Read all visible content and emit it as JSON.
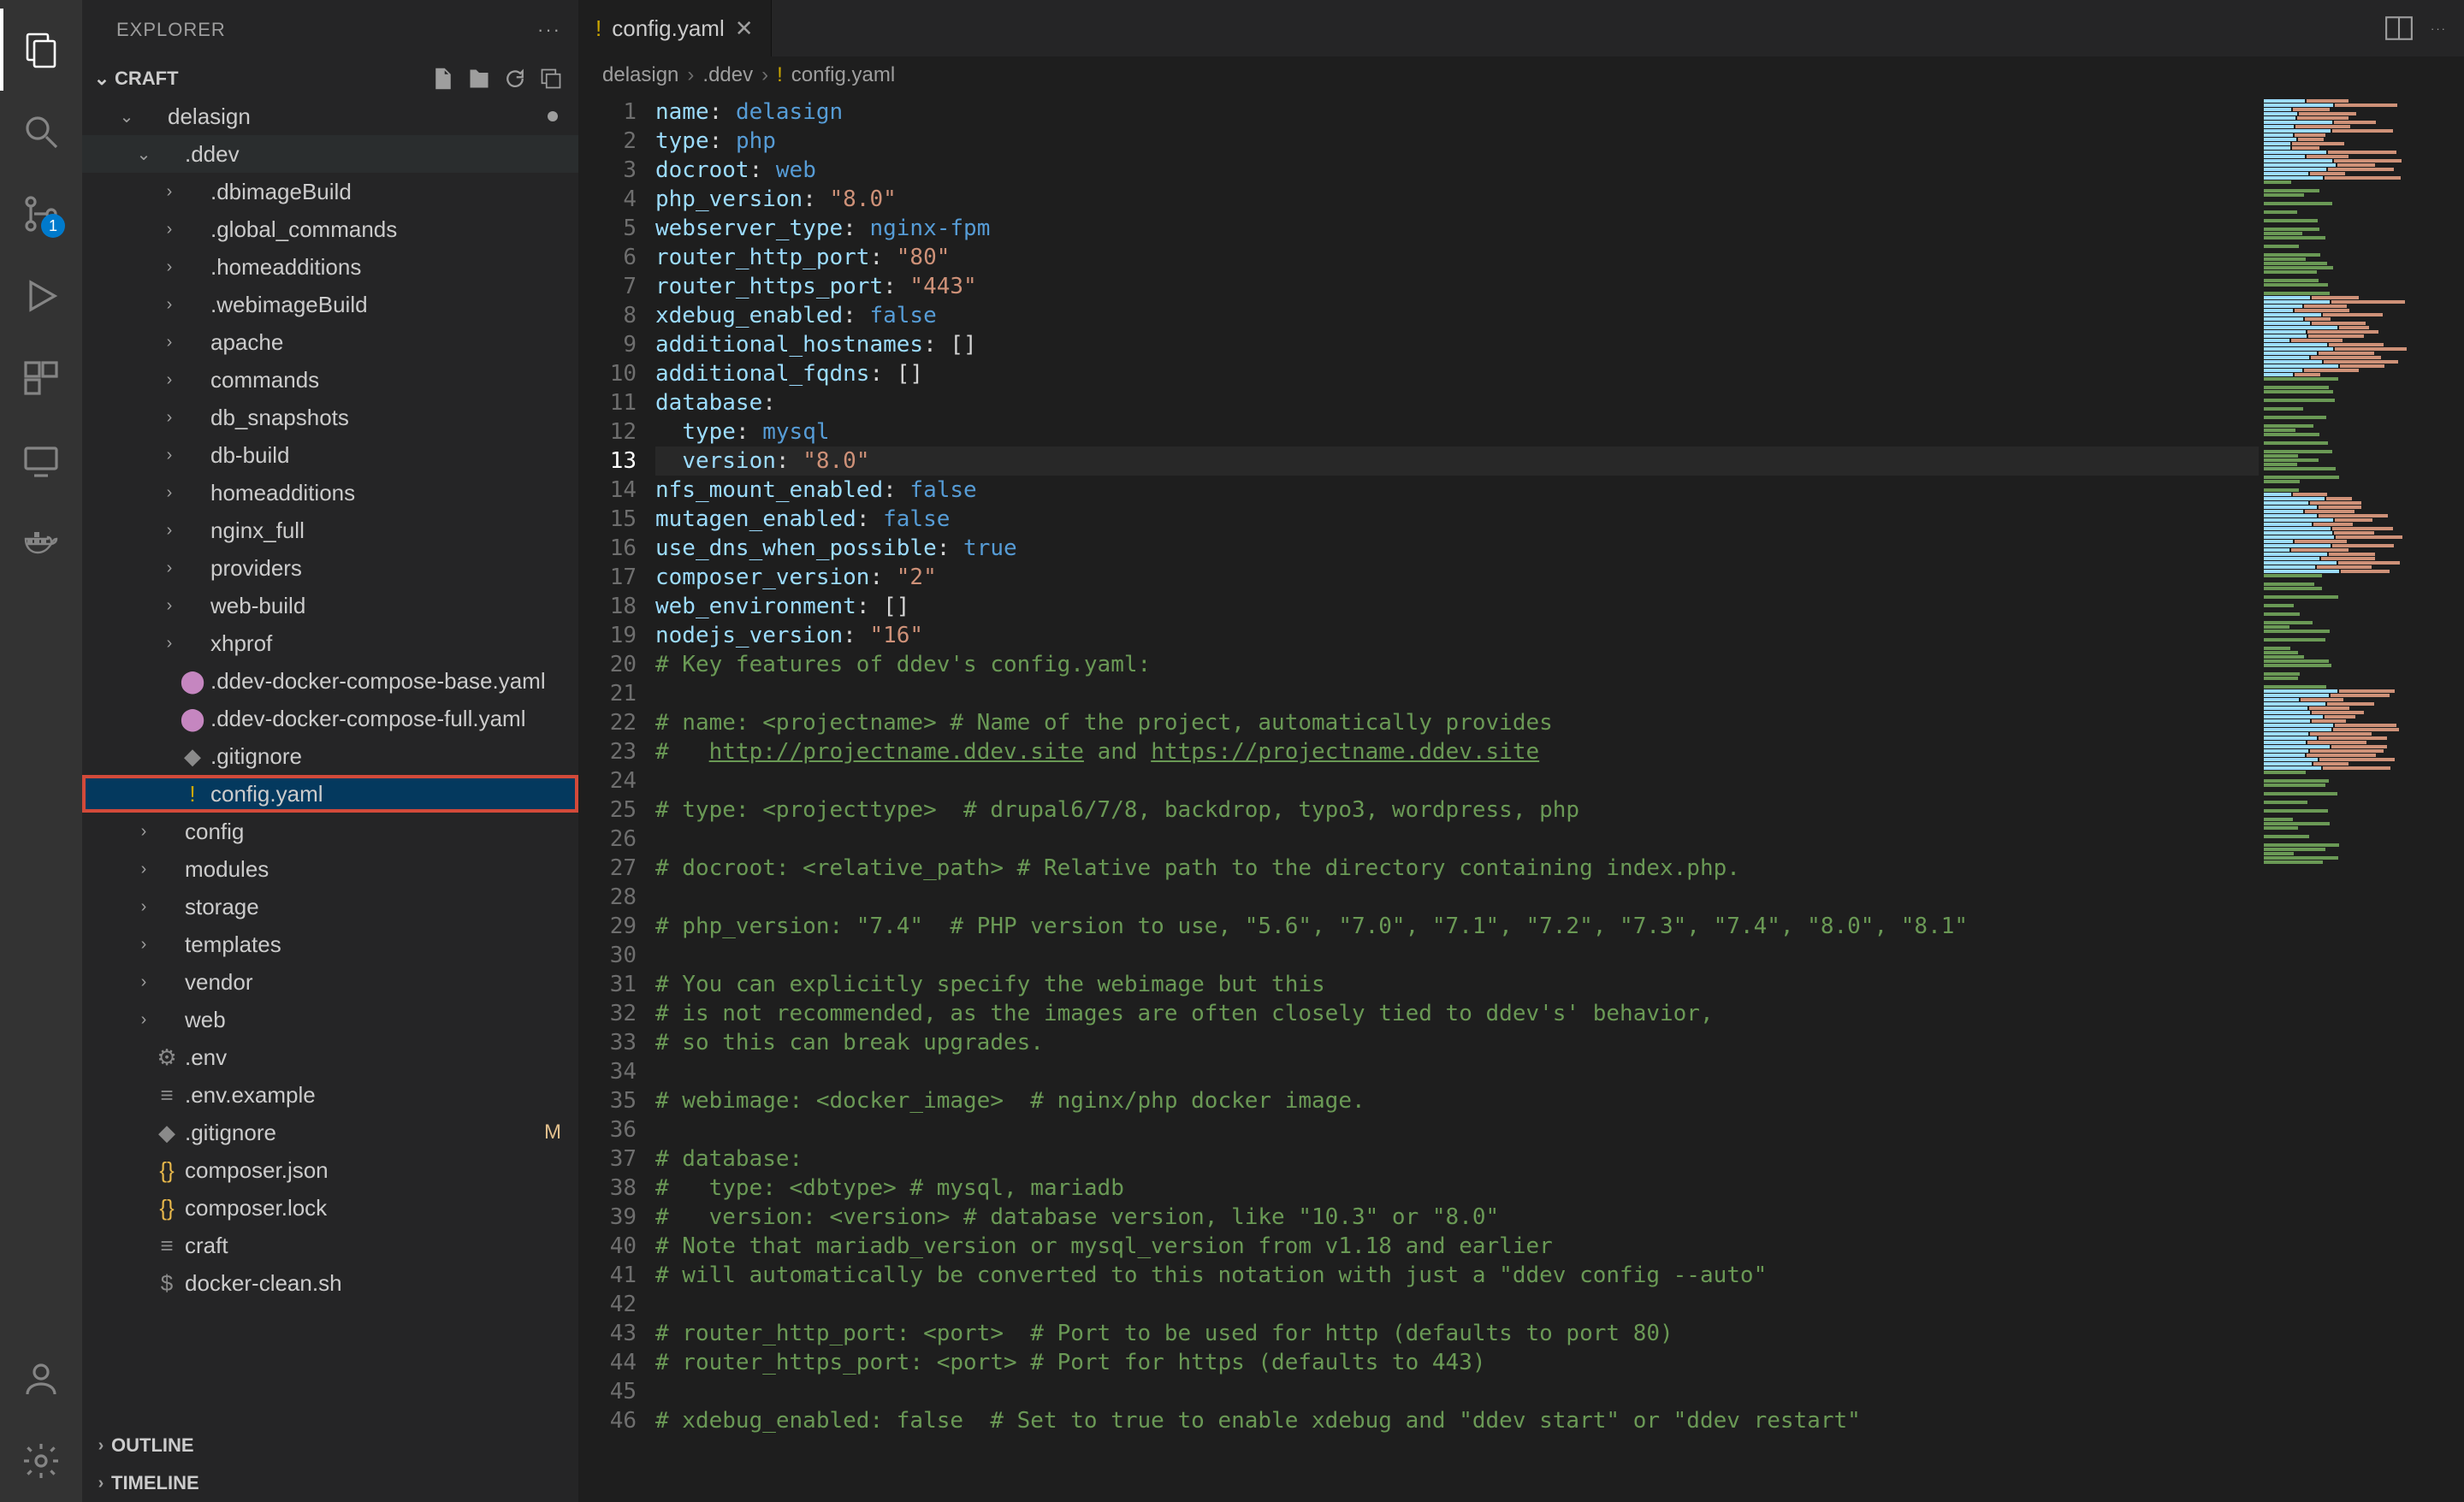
{
  "explorer_title": "EXPLORER",
  "workspace_name": "CRAFT",
  "branch_badge": "1",
  "sidebar_sections": {
    "outline": "OUTLINE",
    "timeline": "TIMELINE"
  },
  "tree": [
    {
      "indent": 0,
      "k": "folder-open",
      "label": "delasign",
      "dot": true
    },
    {
      "indent": 1,
      "k": "folder-open",
      "label": ".ddev",
      "hover": true
    },
    {
      "indent": 2,
      "k": "folder",
      "label": ".dbimageBuild"
    },
    {
      "indent": 2,
      "k": "folder",
      "label": ".global_commands"
    },
    {
      "indent": 2,
      "k": "folder",
      "label": ".homeadditions"
    },
    {
      "indent": 2,
      "k": "folder",
      "label": ".webimageBuild"
    },
    {
      "indent": 2,
      "k": "folder",
      "label": "apache"
    },
    {
      "indent": 2,
      "k": "folder",
      "label": "commands"
    },
    {
      "indent": 2,
      "k": "folder",
      "label": "db_snapshots"
    },
    {
      "indent": 2,
      "k": "folder",
      "label": "db-build"
    },
    {
      "indent": 2,
      "k": "folder",
      "label": "homeadditions"
    },
    {
      "indent": 2,
      "k": "folder",
      "label": "nginx_full"
    },
    {
      "indent": 2,
      "k": "folder",
      "label": "providers"
    },
    {
      "indent": 2,
      "k": "folder",
      "label": "web-build"
    },
    {
      "indent": 2,
      "k": "folder",
      "label": "xhprof"
    },
    {
      "indent": 2,
      "k": "yaml-pink",
      "label": ".ddev-docker-compose-base.yaml"
    },
    {
      "indent": 2,
      "k": "yaml-pink",
      "label": ".ddev-docker-compose-full.yaml"
    },
    {
      "indent": 2,
      "k": "gitignore",
      "label": ".gitignore"
    },
    {
      "indent": 2,
      "k": "yaml-warn",
      "label": "config.yaml",
      "selected": true
    },
    {
      "indent": 1,
      "k": "folder",
      "label": "config"
    },
    {
      "indent": 1,
      "k": "folder",
      "label": "modules"
    },
    {
      "indent": 1,
      "k": "folder",
      "label": "storage"
    },
    {
      "indent": 1,
      "k": "folder",
      "label": "templates"
    },
    {
      "indent": 1,
      "k": "folder",
      "label": "vendor"
    },
    {
      "indent": 1,
      "k": "folder",
      "label": "web"
    },
    {
      "indent": 1,
      "k": "gear",
      "label": ".env"
    },
    {
      "indent": 1,
      "k": "lines",
      "label": ".env.example"
    },
    {
      "indent": 1,
      "k": "gitignore",
      "label": ".gitignore",
      "m": "M"
    },
    {
      "indent": 1,
      "k": "json",
      "label": "composer.json"
    },
    {
      "indent": 1,
      "k": "json",
      "label": "composer.lock"
    },
    {
      "indent": 1,
      "k": "lines",
      "label": "craft"
    },
    {
      "indent": 1,
      "k": "dollar",
      "label": "docker-clean.sh"
    }
  ],
  "tab": {
    "name": "config.yaml"
  },
  "breadcrumb": [
    "delasign",
    ".ddev",
    "config.yaml"
  ],
  "code": [
    {
      "n": 1,
      "t": "kv",
      "key": "name",
      "val": "delasign",
      "vtype": "ident"
    },
    {
      "n": 2,
      "t": "kv",
      "key": "type",
      "val": "php",
      "vtype": "ident"
    },
    {
      "n": 3,
      "t": "kv",
      "key": "docroot",
      "val": "web",
      "vtype": "ident"
    },
    {
      "n": 4,
      "t": "kv",
      "key": "php_version",
      "val": "\"8.0\"",
      "vtype": "str"
    },
    {
      "n": 5,
      "t": "kv",
      "key": "webserver_type",
      "val": "nginx-fpm",
      "vtype": "ident"
    },
    {
      "n": 6,
      "t": "kv",
      "key": "router_http_port",
      "val": "\"80\"",
      "vtype": "str"
    },
    {
      "n": 7,
      "t": "kv",
      "key": "router_https_port",
      "val": "\"443\"",
      "vtype": "str"
    },
    {
      "n": 8,
      "t": "kv",
      "key": "xdebug_enabled",
      "val": "false",
      "vtype": "bool"
    },
    {
      "n": 9,
      "t": "kv",
      "key": "additional_hostnames",
      "val": "[]",
      "vtype": "punct"
    },
    {
      "n": 10,
      "t": "kv",
      "key": "additional_fqdns",
      "val": "[]",
      "vtype": "punct"
    },
    {
      "n": 11,
      "t": "kv",
      "key": "database",
      "val": "",
      "vtype": "none"
    },
    {
      "n": 12,
      "t": "kv",
      "key": "type",
      "val": "mysql",
      "vtype": "ident",
      "indent": 1
    },
    {
      "n": 13,
      "t": "kv",
      "key": "version",
      "val": "\"8.0\"",
      "vtype": "str",
      "indent": 1,
      "current": true
    },
    {
      "n": 14,
      "t": "kv",
      "key": "nfs_mount_enabled",
      "val": "false",
      "vtype": "bool"
    },
    {
      "n": 15,
      "t": "kv",
      "key": "mutagen_enabled",
      "val": "false",
      "vtype": "bool"
    },
    {
      "n": 16,
      "t": "kv",
      "key": "use_dns_when_possible",
      "val": "true",
      "vtype": "bool"
    },
    {
      "n": 17,
      "t": "kv",
      "key": "composer_version",
      "val": "\"2\"",
      "vtype": "str"
    },
    {
      "n": 18,
      "t": "kv",
      "key": "web_environment",
      "val": "[]",
      "vtype": "punct"
    },
    {
      "n": 19,
      "t": "kv",
      "key": "nodejs_version",
      "val": "\"16\"",
      "vtype": "str"
    },
    {
      "n": 20,
      "t": "c",
      "text": "# Key features of ddev's config.yaml:"
    },
    {
      "n": 21,
      "t": "blank"
    },
    {
      "n": 22,
      "t": "c",
      "text": "# name: <projectname> # Name of the project, automatically provides"
    },
    {
      "n": 23,
      "t": "clinks",
      "prefix": "#   ",
      "links": [
        "http://projectname.ddev.site",
        " and ",
        "https://projectname.ddev.site"
      ]
    },
    {
      "n": 24,
      "t": "blank"
    },
    {
      "n": 25,
      "t": "c",
      "text": "# type: <projecttype>  # drupal6/7/8, backdrop, typo3, wordpress, php"
    },
    {
      "n": 26,
      "t": "blank"
    },
    {
      "n": 27,
      "t": "c",
      "text": "# docroot: <relative_path> # Relative path to the directory containing index.php."
    },
    {
      "n": 28,
      "t": "blank"
    },
    {
      "n": 29,
      "t": "c",
      "text": "# php_version: \"7.4\"  # PHP version to use, \"5.6\", \"7.0\", \"7.1\", \"7.2\", \"7.3\", \"7.4\", \"8.0\", \"8.1\""
    },
    {
      "n": 30,
      "t": "blank"
    },
    {
      "n": 31,
      "t": "c",
      "text": "# You can explicitly specify the webimage but this"
    },
    {
      "n": 32,
      "t": "c",
      "text": "# is not recommended, as the images are often closely tied to ddev's' behavior,"
    },
    {
      "n": 33,
      "t": "c",
      "text": "# so this can break upgrades."
    },
    {
      "n": 34,
      "t": "blank"
    },
    {
      "n": 35,
      "t": "c",
      "text": "# webimage: <docker_image>  # nginx/php docker image."
    },
    {
      "n": 36,
      "t": "blank"
    },
    {
      "n": 37,
      "t": "c",
      "text": "# database:"
    },
    {
      "n": 38,
      "t": "c",
      "text": "#   type: <dbtype> # mysql, mariadb"
    },
    {
      "n": 39,
      "t": "c",
      "text": "#   version: <version> # database version, like \"10.3\" or \"8.0\""
    },
    {
      "n": 40,
      "t": "c",
      "text": "# Note that mariadb_version or mysql_version from v1.18 and earlier"
    },
    {
      "n": 41,
      "t": "c",
      "text": "# will automatically be converted to this notation with just a \"ddev config --auto\""
    },
    {
      "n": 42,
      "t": "blank"
    },
    {
      "n": 43,
      "t": "c",
      "text": "# router_http_port: <port>  # Port to be used for http (defaults to port 80)"
    },
    {
      "n": 44,
      "t": "c",
      "text": "# router_https_port: <port> # Port for https (defaults to 443)"
    },
    {
      "n": 45,
      "t": "blank"
    },
    {
      "n": 46,
      "t": "c",
      "text": "# xdebug_enabled: false  # Set to true to enable xdebug and \"ddev start\" or \"ddev restart\""
    }
  ],
  "chart_data": null
}
